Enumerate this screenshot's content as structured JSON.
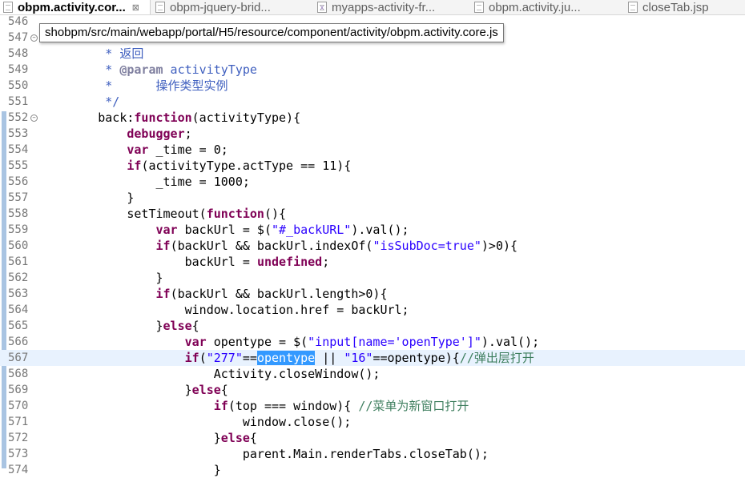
{
  "tabs": [
    {
      "label": "obpm.activity.cor...",
      "active": true,
      "icon": "js-file-icon",
      "closable": true
    },
    {
      "label": "obpm-jquery-brid...",
      "active": false,
      "icon": "js-file-icon"
    },
    {
      "label": "myapps-activity-fr...",
      "active": false,
      "icon": "xml-file-icon"
    },
    {
      "label": "obpm.activity.ju...",
      "active": false,
      "icon": "js-file-icon"
    },
    {
      "label": "closeTab.jsp",
      "active": false,
      "icon": "jsp-file-icon"
    }
  ],
  "tab_close_symbol": "⊠",
  "tooltip": "shobpm/src/main/webapp/portal/H5/resource/component/activity/obpm.activity.core.js",
  "editor": {
    "current_line": "567",
    "selected_word": "opentype",
    "lines": [
      {
        "n": "546",
        "parts": [
          [
            "t",
            "          ,"
          ]
        ]
      },
      {
        "n": "547",
        "parts": [
          [
            "t",
            ""
          ]
        ]
      },
      {
        "n": "548",
        "parts": [
          [
            "jd",
            "         * 返回"
          ]
        ]
      },
      {
        "n": "549",
        "parts": [
          [
            "jd",
            "         * "
          ],
          [
            "jdtag",
            "@param"
          ],
          [
            "jd",
            " activityType"
          ]
        ]
      },
      {
        "n": "550",
        "parts": [
          [
            "jd",
            "         *      操作类型实例"
          ]
        ]
      },
      {
        "n": "551",
        "parts": [
          [
            "jd",
            "         */"
          ]
        ]
      },
      {
        "n": "552",
        "parts": [
          [
            "t",
            "        back:"
          ],
          [
            "kw",
            "function"
          ],
          [
            "t",
            "(activityType){"
          ]
        ]
      },
      {
        "n": "553",
        "parts": [
          [
            "t",
            "            "
          ],
          [
            "kw",
            "debugger"
          ],
          [
            "t",
            ";"
          ]
        ]
      },
      {
        "n": "554",
        "parts": [
          [
            "t",
            "            "
          ],
          [
            "kw",
            "var"
          ],
          [
            "t",
            " _time = 0;"
          ]
        ]
      },
      {
        "n": "555",
        "parts": [
          [
            "t",
            "            "
          ],
          [
            "kw",
            "if"
          ],
          [
            "t",
            "(activityType.actType == 11){"
          ]
        ]
      },
      {
        "n": "556",
        "parts": [
          [
            "t",
            "                _time = 1000;"
          ]
        ]
      },
      {
        "n": "557",
        "parts": [
          [
            "t",
            "            }"
          ]
        ]
      },
      {
        "n": "558",
        "parts": [
          [
            "t",
            "            setTimeout("
          ],
          [
            "kw",
            "function"
          ],
          [
            "t",
            "(){"
          ]
        ]
      },
      {
        "n": "559",
        "parts": [
          [
            "t",
            "                "
          ],
          [
            "kw",
            "var"
          ],
          [
            "t",
            " backUrl = $("
          ],
          [
            "str",
            "\"#_backURL\""
          ],
          [
            "t",
            ").val();"
          ]
        ]
      },
      {
        "n": "560",
        "parts": [
          [
            "t",
            "                "
          ],
          [
            "kw",
            "if"
          ],
          [
            "t",
            "(backUrl && backUrl.indexOf("
          ],
          [
            "str",
            "\"isSubDoc=true\""
          ],
          [
            "t",
            ")>0){"
          ]
        ]
      },
      {
        "n": "561",
        "parts": [
          [
            "t",
            "                    backUrl = "
          ],
          [
            "kw",
            "undefined"
          ],
          [
            "t",
            ";"
          ]
        ]
      },
      {
        "n": "562",
        "parts": [
          [
            "t",
            "                }"
          ]
        ]
      },
      {
        "n": "563",
        "parts": [
          [
            "t",
            "                "
          ],
          [
            "kw",
            "if"
          ],
          [
            "t",
            "(backUrl && backUrl.length>0){"
          ]
        ]
      },
      {
        "n": "564",
        "parts": [
          [
            "t",
            "                    window.location.href = backUrl;"
          ]
        ]
      },
      {
        "n": "565",
        "parts": [
          [
            "t",
            "                }"
          ],
          [
            "kw",
            "else"
          ],
          [
            "t",
            "{"
          ]
        ]
      },
      {
        "n": "566",
        "parts": [
          [
            "t",
            "                    "
          ],
          [
            "kw",
            "var"
          ],
          [
            "t",
            " opentype = $("
          ],
          [
            "str",
            "\"input[name='openType']\""
          ],
          [
            "t",
            ").val();"
          ]
        ]
      },
      {
        "n": "567",
        "parts": [
          [
            "t",
            "                    "
          ],
          [
            "kw",
            "if"
          ],
          [
            "t",
            "("
          ],
          [
            "str",
            "\"277\""
          ],
          [
            "t",
            "=="
          ],
          [
            "hl",
            "opentype"
          ],
          [
            "t",
            " || "
          ],
          [
            "str",
            "\"16\""
          ],
          [
            "t",
            "==opentype){"
          ],
          [
            "cm",
            "//弹出层打开"
          ]
        ]
      },
      {
        "n": "568",
        "parts": [
          [
            "t",
            "                        Activity.closeWindow();"
          ]
        ]
      },
      {
        "n": "569",
        "parts": [
          [
            "t",
            "                    }"
          ],
          [
            "kw",
            "else"
          ],
          [
            "t",
            "{"
          ]
        ]
      },
      {
        "n": "570",
        "parts": [
          [
            "t",
            "                        "
          ],
          [
            "kw",
            "if"
          ],
          [
            "t",
            "(top === window){ "
          ],
          [
            "cm",
            "//菜单为新窗口打开"
          ]
        ]
      },
      {
        "n": "571",
        "parts": [
          [
            "t",
            "                            window.close();"
          ]
        ]
      },
      {
        "n": "572",
        "parts": [
          [
            "t",
            "                        }"
          ],
          [
            "kw",
            "else"
          ],
          [
            "t",
            "{"
          ]
        ]
      },
      {
        "n": "573",
        "parts": [
          [
            "t",
            "                            parent.Main.renderTabs.closeTab();"
          ]
        ]
      },
      {
        "n": "574",
        "parts": [
          [
            "t",
            "                        }"
          ]
        ]
      }
    ]
  }
}
